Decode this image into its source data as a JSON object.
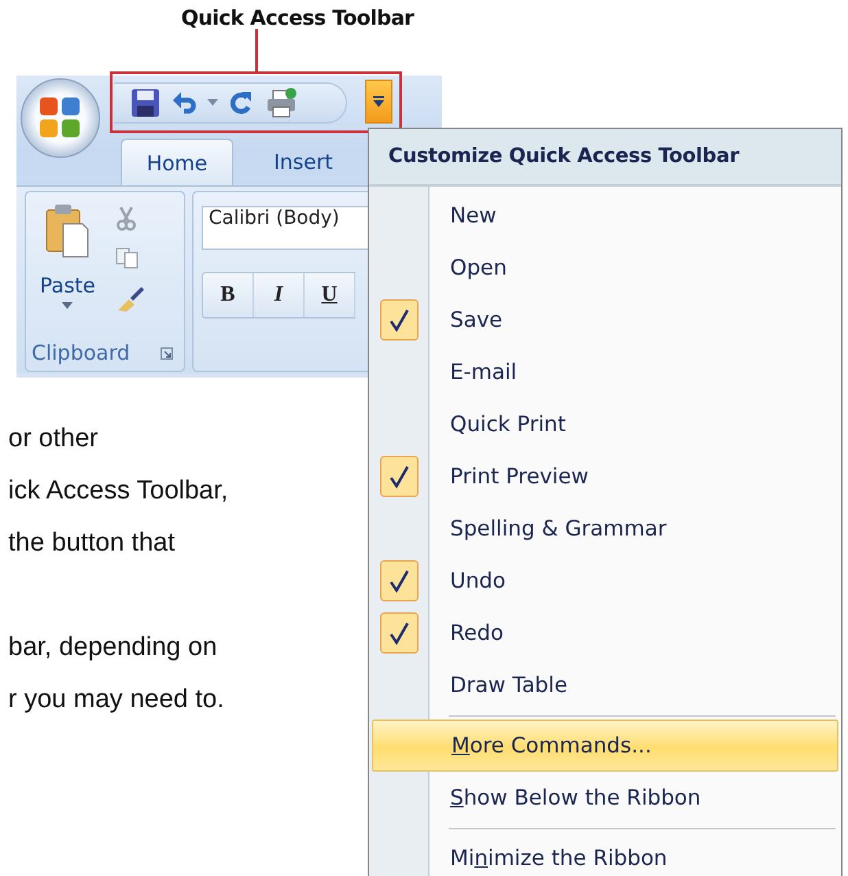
{
  "callout": {
    "label": "Quick Access Toolbar"
  },
  "ribbon": {
    "tabs": [
      {
        "label": "Home",
        "selected": true
      },
      {
        "label": "Insert",
        "selected": false
      }
    ],
    "clipboard_group": {
      "paste_label": "Paste",
      "group_label": "Clipboard"
    },
    "font_group": {
      "font_name": "Calibri (Body)",
      "format_buttons": [
        "B",
        "I",
        "U"
      ]
    }
  },
  "document_text": {
    "paragraphs": [
      [
        "or other",
        "ick Access Toolbar,",
        "the button that"
      ],
      [
        "bar, depending on",
        "r you may need to."
      ]
    ]
  },
  "menu": {
    "title": "Customize Quick Access Toolbar",
    "items": [
      {
        "kind": "item",
        "label": "New",
        "checked": false,
        "selected": false
      },
      {
        "kind": "item",
        "label": "Open",
        "checked": false,
        "selected": false
      },
      {
        "kind": "item",
        "label": "Save",
        "checked": true,
        "selected": false
      },
      {
        "kind": "item",
        "label": "E-mail",
        "checked": false,
        "selected": false
      },
      {
        "kind": "item",
        "label": "Quick Print",
        "checked": false,
        "selected": false
      },
      {
        "kind": "item",
        "label": "Print Preview",
        "checked": true,
        "selected": false
      },
      {
        "kind": "item",
        "label": "Spelling & Grammar",
        "checked": false,
        "selected": false
      },
      {
        "kind": "item",
        "label": "Undo",
        "checked": true,
        "selected": false
      },
      {
        "kind": "item",
        "label": "Redo",
        "checked": true,
        "selected": false
      },
      {
        "kind": "item",
        "label": "Draw Table",
        "checked": false,
        "selected": false
      },
      {
        "kind": "separator"
      },
      {
        "kind": "item",
        "access_key": "M",
        "label_end": "ore Commands...",
        "checked": false,
        "selected": true
      },
      {
        "kind": "item",
        "access_key": "S",
        "label_end": "how Below the Ribbon",
        "checked": false,
        "selected": false
      },
      {
        "kind": "separator"
      },
      {
        "kind": "item",
        "label_start": "Mi",
        "access_key": "n",
        "label_end": "imize the Ribbon",
        "checked": false,
        "selected": false
      }
    ]
  }
}
